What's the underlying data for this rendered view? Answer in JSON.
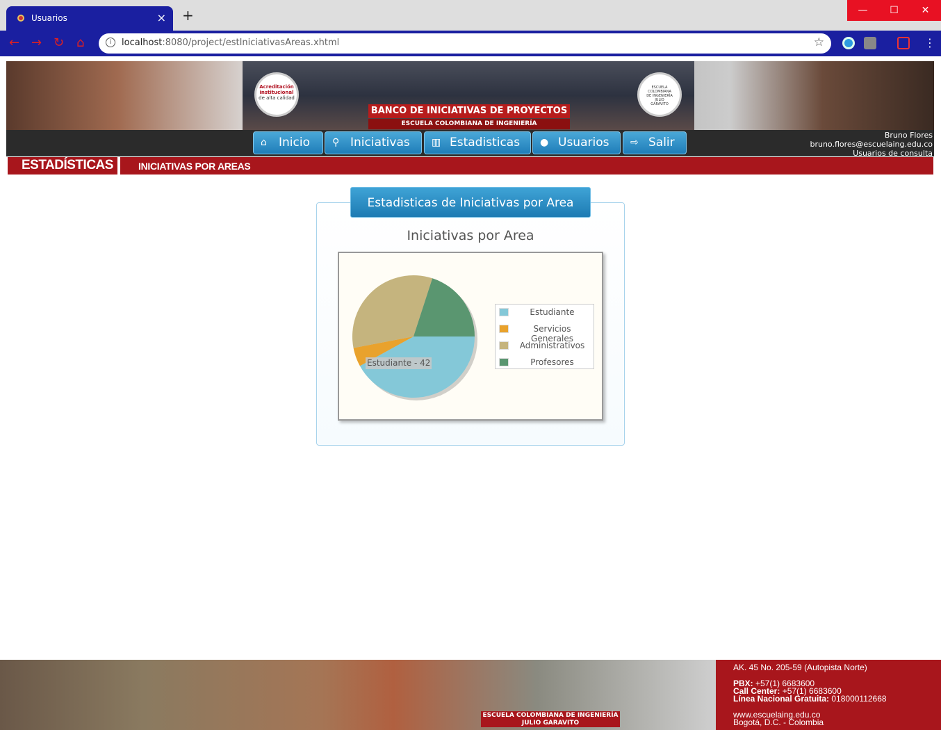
{
  "browser": {
    "tab_title": "Usuarios",
    "url_host": "localhost",
    "url_rest": ":8080/project/estIniciativasAreas.xhtml"
  },
  "banner": {
    "title": "BANCO DE INICIATIVAS DE PROYECTOS",
    "subtitle": "ESCUELA COLOMBIANA DE INGENIERÍA",
    "seal_left_line1": "Acreditación",
    "seal_left_line2": "institucional",
    "seal_left_line3": "de alta calidad",
    "seal_right_lines": "ESCUELA COLOMBIANA DE INGENIERÍA JULIO GARAVITO"
  },
  "nav": {
    "items": [
      {
        "label": "Inicio",
        "icon": "home-icon"
      },
      {
        "label": "Iniciativas",
        "icon": "lightbulb-icon"
      },
      {
        "label": "Estadisticas",
        "icon": "bar-chart-icon"
      },
      {
        "label": "Usuarios",
        "icon": "user-icon"
      },
      {
        "label": "Salir",
        "icon": "sign-out-icon"
      }
    ]
  },
  "user": {
    "name": "Bruno Flores",
    "email": "bruno.flores@escuelaing.edu.co",
    "role": "Usuarios de consulta"
  },
  "section": {
    "title": "ESTADÍSTICAS",
    "subtitle": "INICIATIVAS POR AREAS"
  },
  "panel": {
    "header": "Estadisticas de Iniciativas por Area"
  },
  "chart_data": {
    "type": "pie",
    "title": "Iniciativas por Area",
    "categories": [
      "Estudiante",
      "Servicios Generales",
      "Administrativos",
      "Profesores"
    ],
    "values": [
      42,
      5,
      33,
      20
    ],
    "colors": [
      "#84c8d8",
      "#e9a22c",
      "#c5b47e",
      "#5a9670"
    ],
    "legend_position": "right",
    "tooltip": "Estudiante - 42"
  },
  "footer": {
    "logo_line1": "ESCUELA COLOMBIANA DE INGENIERÍA",
    "logo_line2": "JULIO GARAVITO",
    "address": "AK. 45 No. 205-59 (Autopista Norte)",
    "pbx_label": "PBX:",
    "pbx": "+57(1) 6683600",
    "callcenter_label": "Call Center:",
    "callcenter": "+57(1) 6683600",
    "linea_label": "Línea Nacional Gratuita:",
    "linea": "018000112668",
    "web": "www.escuelaing.edu.co",
    "city": "Bogotá, D.C. - Colombia"
  }
}
